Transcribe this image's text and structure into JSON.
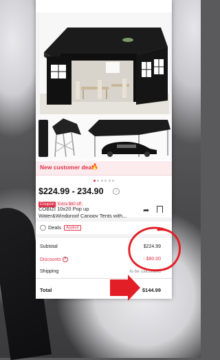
{
  "deal_banner": {
    "text": "New customer deal"
  },
  "carousel": {
    "count": 6,
    "active_index": 0
  },
  "product": {
    "price": "$224.99 - 234.90",
    "coupon_label": "Coupon",
    "coupon_extra": "Extra $80 off",
    "title_line1": "COBIZI 10x20 Pop up",
    "title_line2": "Water&Windproof Canopy Tents with..."
  },
  "deals": {
    "label": "Deals",
    "applied": "Applied"
  },
  "summary": {
    "subtotal_label": "Subtotal",
    "subtotal_value": "$224.99",
    "discounts_label": "Discounts",
    "discounts_value": "- $80.00",
    "shipping_label": "Shipping",
    "shipping_value": "to be calculated",
    "total_label": "Total",
    "total_value": "$144.99"
  },
  "icons": {
    "flame": "flame-icon",
    "info": "info-icon",
    "share": "share-icon",
    "bookmark": "bookmark-icon",
    "tag": "tag-icon",
    "question": "question-icon"
  },
  "colors": {
    "accent": "#e0304a",
    "annotation": "#e21f26"
  }
}
